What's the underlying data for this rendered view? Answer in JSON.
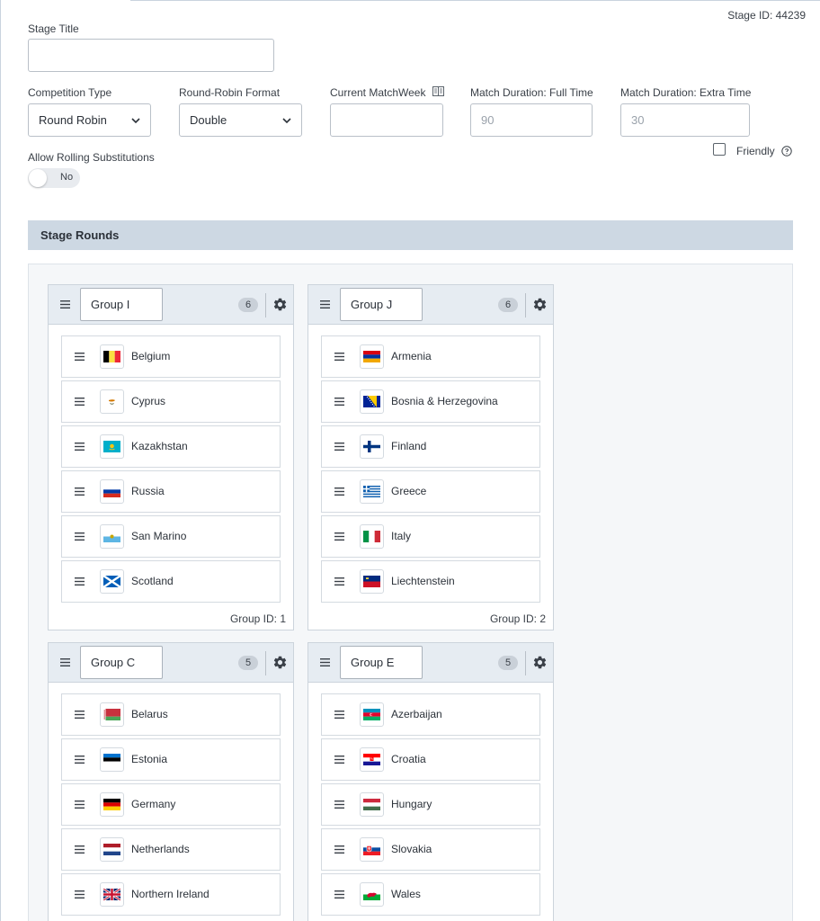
{
  "stage_id": "Stage ID: 44239",
  "form": {
    "stage_title_label": "Stage Title",
    "stage_title_value": "",
    "competition_type_label": "Competition Type",
    "competition_type_value": "Round Robin",
    "round_robin_format_label": "Round-Robin Format",
    "round_robin_format_value": "Double",
    "current_matchweek_label": "Current MatchWeek",
    "current_matchweek_value": "",
    "full_time_label": "Match Duration: Full Time",
    "full_time_placeholder": "90",
    "extra_time_label": "Match Duration: Extra Time",
    "extra_time_placeholder": "30",
    "friendly_label": "Friendly",
    "friendly_checked": false,
    "rolling_subs_label": "Allow Rolling Substitutions",
    "rolling_subs_value": "No"
  },
  "section_title": "Stage Rounds",
  "groups": [
    {
      "name": "Group I",
      "count": "6",
      "group_id": "Group ID: 1",
      "teams": [
        {
          "name": "Belgium",
          "flag": "belgium-flag-icon"
        },
        {
          "name": "Cyprus",
          "flag": "cyprus-flag-icon"
        },
        {
          "name": "Kazakhstan",
          "flag": "kazakhstan-flag-icon"
        },
        {
          "name": "Russia",
          "flag": "russia-flag-icon"
        },
        {
          "name": "San Marino",
          "flag": "san-marino-flag-icon"
        },
        {
          "name": "Scotland",
          "flag": "scotland-flag-icon"
        }
      ]
    },
    {
      "name": "Group J",
      "count": "6",
      "group_id": "Group ID: 2",
      "teams": [
        {
          "name": "Armenia",
          "flag": "armenia-flag-icon"
        },
        {
          "name": "Bosnia & Herzegovina",
          "flag": "bosnia-flag-icon"
        },
        {
          "name": "Finland",
          "flag": "finland-flag-icon"
        },
        {
          "name": "Greece",
          "flag": "greece-flag-icon"
        },
        {
          "name": "Italy",
          "flag": "italy-flag-icon"
        },
        {
          "name": "Liechtenstein",
          "flag": "liechtenstein-flag-icon"
        }
      ]
    },
    {
      "name": "Group C",
      "count": "5",
      "group_id": "",
      "teams": [
        {
          "name": "Belarus",
          "flag": "belarus-flag-icon"
        },
        {
          "name": "Estonia",
          "flag": "estonia-flag-icon"
        },
        {
          "name": "Germany",
          "flag": "germany-flag-icon"
        },
        {
          "name": "Netherlands",
          "flag": "netherlands-flag-icon"
        },
        {
          "name": "Northern Ireland",
          "flag": "northern-ireland-flag-icon"
        }
      ]
    },
    {
      "name": "Group E",
      "count": "5",
      "group_id": "",
      "teams": [
        {
          "name": "Azerbaijan",
          "flag": "azerbaijan-flag-icon"
        },
        {
          "name": "Croatia",
          "flag": "croatia-flag-icon"
        },
        {
          "name": "Hungary",
          "flag": "hungary-flag-icon"
        },
        {
          "name": "Slovakia",
          "flag": "slovakia-flag-icon"
        },
        {
          "name": "Wales",
          "flag": "wales-flag-icon"
        }
      ]
    }
  ]
}
